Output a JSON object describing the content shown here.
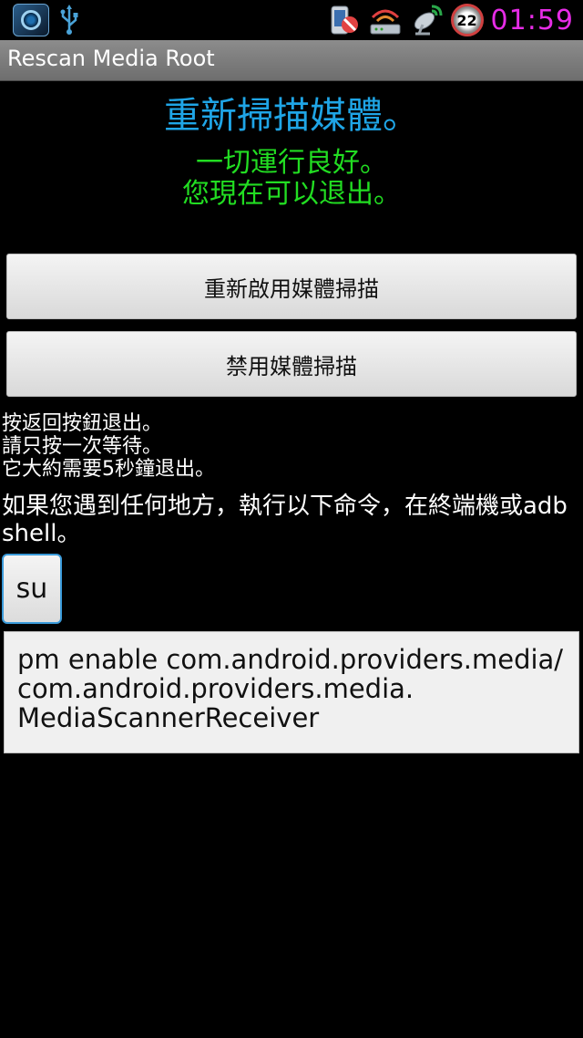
{
  "status_bar": {
    "left_icons": [
      "camera-app-icon",
      "usb-icon"
    ],
    "right_icons": [
      "phone-mute-icon",
      "wifi-router-icon",
      "satellite-icon"
    ],
    "badge": "22",
    "clock": "01:59",
    "clock_color": "#e62ce6"
  },
  "title_bar": {
    "title": "Rescan Media Root"
  },
  "main": {
    "heading": "重新掃描媒體。",
    "heading_color": "#1fa5e6",
    "status_line1": "一切運行良好。",
    "status_line2": "您現在可以退出。",
    "status_color": "#22dd22",
    "buttons": {
      "reenable": "重新啟用媒體掃描",
      "disable": "禁用媒體掃描"
    },
    "instructions": [
      "按返回按鈕退出。",
      "請只按一次等待。",
      "它大約需要5秒鐘退出。"
    ],
    "help_text": "如果您遇到任何地方，執行以下命令，在終端機或adb shell。",
    "su_label": "su",
    "command": "pm enable com.android.providers.media/\ncom.android.providers.media.\nMediaScannerReceiver"
  }
}
